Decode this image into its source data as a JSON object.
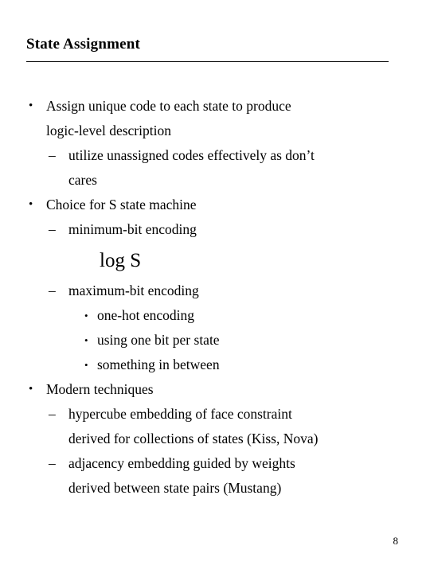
{
  "slide": {
    "title": "State Assignment",
    "page_number": "8",
    "bullet_glyph_level1": "•",
    "bullet_glyph_level2": "–",
    "bullet_glyph_level3": "•",
    "content": [
      {
        "level": 1,
        "lines": [
          "Assign unique code to each state to produce",
          "logic-level description"
        ]
      },
      {
        "level": 2,
        "lines": [
          "utilize unassigned codes effectively as don’t",
          "cares"
        ]
      },
      {
        "level": 1,
        "lines": [
          "Choice for S state machine"
        ]
      },
      {
        "level": 2,
        "lines": [
          "minimum-bit encoding"
        ]
      },
      {
        "level": "formula",
        "lines": [
          "log S"
        ]
      },
      {
        "level": 2,
        "lines": [
          "maximum-bit encoding"
        ]
      },
      {
        "level": 3,
        "lines": [
          "one-hot encoding"
        ]
      },
      {
        "level": 3,
        "lines": [
          "using one bit per state"
        ]
      },
      {
        "level": 3,
        "lines": [
          "something in between"
        ]
      },
      {
        "level": 1,
        "lines": [
          "Modern techniques"
        ]
      },
      {
        "level": 2,
        "lines": [
          "hypercube embedding of face constraint",
          "derived for collections of states (Kiss, Nova)"
        ]
      },
      {
        "level": 2,
        "lines": [
          "adjacency embedding guided by weights",
          "derived between state pairs (Mustang)"
        ]
      }
    ]
  }
}
